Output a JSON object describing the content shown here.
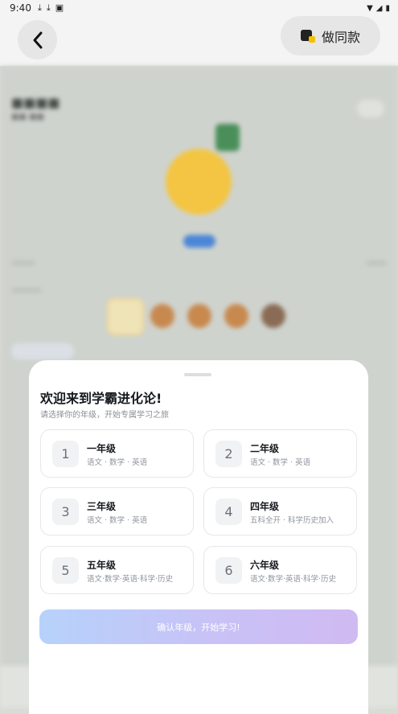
{
  "status_bar": {
    "time": "9:40"
  },
  "header": {
    "make_same_label": "做同款"
  },
  "sheet": {
    "title": "欢迎来到学霸进化论!",
    "subtitle": "请选择你的年级，开始专属学习之旅",
    "grades": [
      {
        "num": "1",
        "name": "一年级",
        "subjects": "语文 · 数学 · 英语"
      },
      {
        "num": "2",
        "name": "二年级",
        "subjects": "语文 · 数学 · 英语"
      },
      {
        "num": "3",
        "name": "三年级",
        "subjects": "语文 · 数学 · 英语"
      },
      {
        "num": "4",
        "name": "四年级",
        "subjects": "五科全开 · 科学历史加入"
      },
      {
        "num": "5",
        "name": "五年级",
        "subjects": "语文·数学·英语·科学·历史"
      },
      {
        "num": "6",
        "name": "六年级",
        "subjects": "语文·数学·英语·科学·历史"
      }
    ],
    "confirm_label": "确认年级，开始学习!"
  },
  "colors": {
    "avatar": "#f4c542",
    "tag": "#4b86d6",
    "confirm_start": "#b6d2fb",
    "confirm_end": "#d0baf2"
  }
}
